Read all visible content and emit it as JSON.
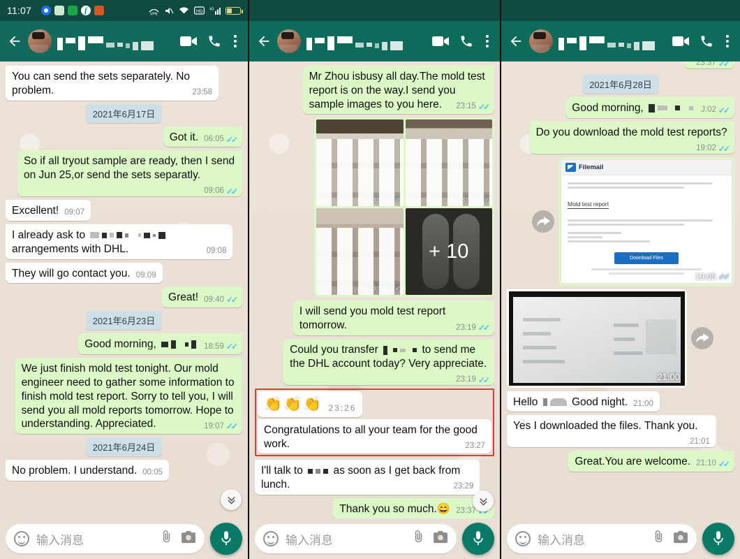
{
  "status_bar": {
    "time": "11:07",
    "notif_icons": [
      "chrome-icon",
      "whatsapp-icon",
      "wechat-icon",
      "facebook-icon",
      "app-orange-icon"
    ],
    "system_icons": [
      "vpn-icon",
      "mute-icon",
      "wifi-icon",
      "hd-icon",
      "signal-4g-icon",
      "battery-icon"
    ]
  },
  "app_bar": {
    "back_icon": "back-arrow-icon",
    "avatar": "contact-avatar",
    "contact_name": "████ ███ ██ ▪ ▄▄",
    "video_call_icon": "video-call-icon",
    "voice_call_icon": "phone-call-icon",
    "menu_icon": "overflow-menu-icon"
  },
  "composer": {
    "emoji_icon": "smiley-icon",
    "placeholder": "输入消息",
    "attach_icon": "paperclip-icon",
    "camera_icon": "camera-icon",
    "mic_icon": "microphone-icon"
  },
  "colors": {
    "app_bar": "#0d6b5c",
    "status_bar": "#0f4a40",
    "outgoing_bubble": "#dcf8c6",
    "incoming_bubble": "#ffffff",
    "chat_background": "#eadfd5",
    "date_chip": "#cfdfe8",
    "tick_blue": "#4fc3f7",
    "highlight_border": "#e03b34",
    "mic_button": "#0a7a68"
  },
  "panel1": {
    "messages": [
      {
        "kind": "bubble",
        "dir": "in",
        "text": "You can send the sets separately. No problem.",
        "time": "23:58",
        "ticks": false
      },
      {
        "kind": "date",
        "text": "2021年6月17日"
      },
      {
        "kind": "bubble",
        "dir": "out",
        "text": "Got it.",
        "time": "06:05",
        "ticks": true
      },
      {
        "kind": "bubble",
        "dir": "out",
        "text": "So if all tryout sample are ready, then I send on Jun 25,or send the sets separatly.",
        "time": "09:06",
        "ticks": true
      },
      {
        "kind": "bubble",
        "dir": "in",
        "text": "Excellent!",
        "time": "09:07",
        "ticks": false
      },
      {
        "kind": "bubble",
        "dir": "in",
        "text_before": "I already ask to",
        "redacted": true,
        "text_after": "arrangements with DHL.",
        "time": "09:08",
        "ticks": false
      },
      {
        "kind": "bubble",
        "dir": "in",
        "text": "They will go contact you.",
        "time": "09:09",
        "ticks": false
      },
      {
        "kind": "bubble",
        "dir": "out",
        "text": "Great!",
        "time": "09:40",
        "ticks": true
      },
      {
        "kind": "date",
        "text": "2021年6月23日"
      },
      {
        "kind": "bubble",
        "dir": "out",
        "text_before": "Good morning,",
        "redacted": true,
        "time": "18:59",
        "ticks": true
      },
      {
        "kind": "bubble",
        "dir": "out",
        "text": "We just finish mold test tonight. Our mold engineer need to gather some information to finish mold test report. Sorry to tell you, I will send you all mold reports tomorrow. Hope to understanding. Appreciated.",
        "time": "19:07",
        "ticks": true
      },
      {
        "kind": "date",
        "text": "2021年6月24日"
      },
      {
        "kind": "bubble",
        "dir": "in",
        "text": "No problem. I understand.",
        "time": "00:05",
        "ticks": false
      }
    ],
    "scroll_fab": "scroll-to-bottom-icon"
  },
  "panel2": {
    "messages": [
      {
        "kind": "bubble",
        "dir": "out",
        "text": "Mr Zhou isbusy all day.The mold test report is on the way.I send you sample images to you here.",
        "time": "23:15",
        "ticks": true
      },
      {
        "kind": "gallery",
        "dir": "out",
        "thumbs": [
          {
            "time": "23:15",
            "ticks": true,
            "overlay": ""
          },
          {
            "time": "23:15",
            "ticks": true,
            "overlay": ""
          },
          {
            "time": "23:15",
            "ticks": true,
            "overlay": ""
          },
          {
            "time": "",
            "ticks": false,
            "overlay": "+ 10"
          }
        ]
      },
      {
        "kind": "bubble",
        "dir": "out",
        "text": "I will send you mold test report tomorrow.",
        "time": "23:19",
        "ticks": true
      },
      {
        "kind": "bubble",
        "dir": "out",
        "text_before": "Could you transfer",
        "redacted": true,
        "text_after": "to send me the DHL account today? Very appreciate.",
        "time": "23:19",
        "ticks": true
      },
      {
        "kind": "emoji",
        "dir": "in",
        "emoji": "👏👏👏",
        "time": "23:26",
        "highlighted": true
      },
      {
        "kind": "bubble",
        "dir": "in",
        "text": "Congratulations to all your team for the good work.",
        "time": "23:27",
        "ticks": false,
        "highlighted": true
      },
      {
        "kind": "bubble",
        "dir": "in",
        "text_before": "I'll talk to",
        "redacted": true,
        "text_after": "as soon as I get back from lunch.",
        "time": "23:29",
        "ticks": false
      },
      {
        "kind": "bubble",
        "dir": "out",
        "text": "Thank you so much.😄",
        "time": "23:37",
        "ticks": true
      }
    ],
    "scroll_fab": "scroll-to-bottom-icon"
  },
  "panel3": {
    "messages": [
      {
        "kind": "partial",
        "time": "23:37",
        "ticks": true
      },
      {
        "kind": "date",
        "text": "2021年6月28日"
      },
      {
        "kind": "bubble",
        "dir": "out",
        "text_before": "Good morning,",
        "redacted": true,
        "time": "J:02",
        "ticks": true
      },
      {
        "kind": "bubble",
        "dir": "out",
        "text": "Do you download the mold test reports?",
        "time": "19:02",
        "ticks": true
      },
      {
        "kind": "document",
        "dir": "out",
        "time": "19:05",
        "ticks": true,
        "doc": {
          "brand": "Filemail",
          "title": "Mold test report",
          "button": "Download Files"
        }
      },
      {
        "kind": "video",
        "dir": "in",
        "time": "21:00",
        "forward_icon": "forward-icon"
      },
      {
        "kind": "bubble",
        "dir": "in",
        "text_before": "Hello",
        "redacted": true,
        "text_after": "Good night.",
        "time": "21:00",
        "ticks": false
      },
      {
        "kind": "bubble",
        "dir": "in",
        "text": "Yes I downloaded the files. Thank you.",
        "time": "21:01",
        "ticks": false
      },
      {
        "kind": "bubble",
        "dir": "out",
        "text": "Great.You are welcome.",
        "time": "21:10",
        "ticks": true
      }
    ]
  }
}
